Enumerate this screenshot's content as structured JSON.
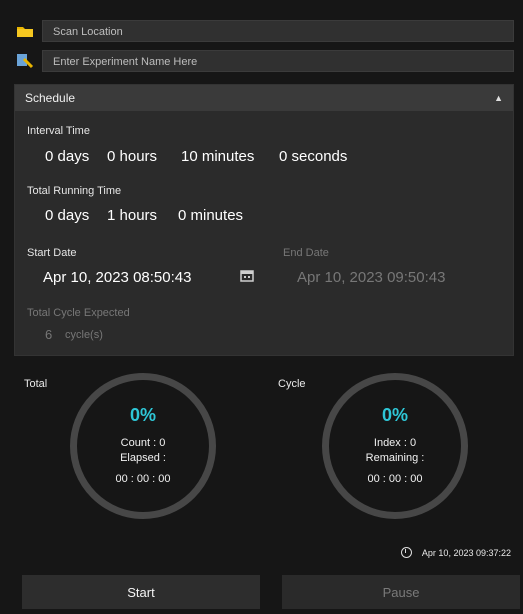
{
  "inputs": {
    "scan_location_placeholder": "Scan Location",
    "experiment_name_placeholder": "Enter Experiment Name Here"
  },
  "schedule": {
    "title": "Schedule",
    "interval_label": "Interval Time",
    "interval": {
      "days": "0 days",
      "hours": "0 hours",
      "minutes": "10 minutes",
      "seconds": "0 seconds"
    },
    "running_label": "Total Running Time",
    "running": {
      "days": "0 days",
      "hours": "1 hours",
      "minutes": "0 minutes"
    },
    "start_date_label": "Start Date",
    "start_date": "Apr 10, 2023 08:50:43",
    "end_date_label": "End Date",
    "end_date": "Apr 10, 2023 09:50:43",
    "cycles_label": "Total Cycle Expected",
    "cycles_count": "6",
    "cycles_unit": "cycle(s)"
  },
  "total": {
    "label": "Total",
    "percent": "0%",
    "count": "Count : 0",
    "elapsed_label": "Elapsed :",
    "elapsed": "00 : 00 : 00"
  },
  "cycle": {
    "label": "Cycle",
    "percent": "0%",
    "index": "Index : 0",
    "remaining_label": "Remaining :",
    "remaining": "00 : 00 : 00"
  },
  "timestamp": "Apr 10, 2023 09:37:22",
  "buttons": {
    "start": "Start",
    "pause": "Pause"
  },
  "colors": {
    "accent": "#2ec6d6",
    "folder": "#e8b400",
    "bg": "#161616"
  }
}
